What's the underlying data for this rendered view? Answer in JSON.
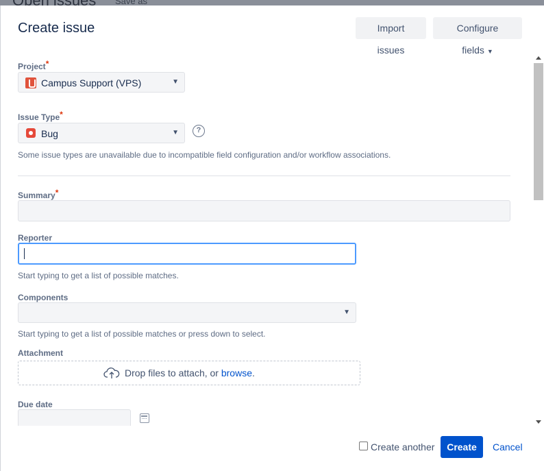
{
  "background": {
    "title": "Open issues",
    "save_as": "Save as"
  },
  "modal": {
    "title": "Create issue",
    "import_label": "Import issues",
    "configure_label": "Configure fields"
  },
  "form": {
    "project": {
      "label": "Project",
      "value": "Campus Support (VPS)"
    },
    "issue_type": {
      "label": "Issue Type",
      "value": "Bug",
      "help": "?",
      "note": "Some issue types are unavailable due to incompatible field configuration and/or workflow associations."
    },
    "summary": {
      "label": "Summary",
      "value": ""
    },
    "reporter": {
      "label": "Reporter",
      "value": "",
      "hint": "Start typing to get a list of possible matches."
    },
    "components": {
      "label": "Components",
      "value": "",
      "hint": "Start typing to get a list of possible matches or press down to select."
    },
    "attachment": {
      "label": "Attachment",
      "drop_text": "Drop files to attach, or ",
      "browse": "browse",
      "period": "."
    },
    "due_date": {
      "label": "Due date",
      "value": ""
    }
  },
  "footer": {
    "create_another": "Create another",
    "create_another_checked": false,
    "create_label": "Create",
    "cancel_label": "Cancel"
  },
  "colors": {
    "primary": "#0052cc",
    "required": "#de350b",
    "focus": "#4c9aff"
  },
  "required_marker": "*"
}
